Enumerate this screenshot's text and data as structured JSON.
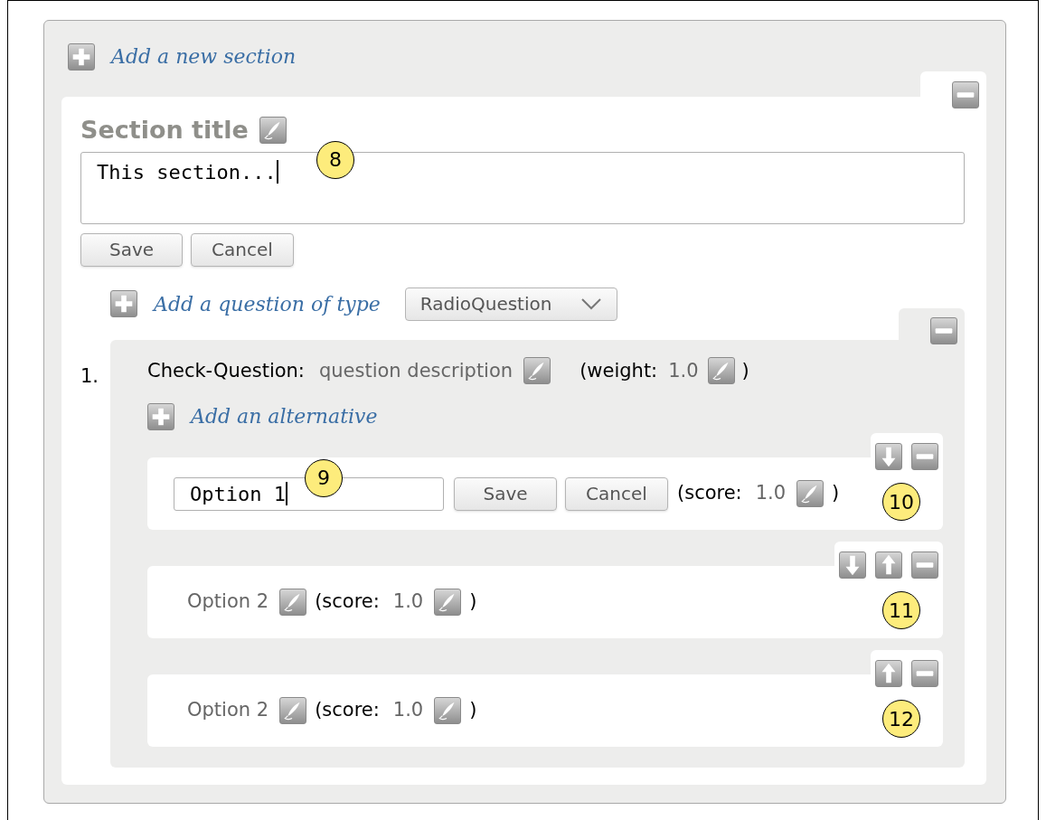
{
  "add_section": {
    "label": "Add a new section"
  },
  "section": {
    "title": "Section title",
    "description": {
      "value": "This section...",
      "focused": true,
      "callout": "8"
    },
    "buttons": [
      "Save",
      "Cancel"
    ],
    "add_question": {
      "label": "Add a question of type",
      "select_value": "RadioQuestion"
    },
    "questions": [
      {
        "number": "1.",
        "type_label": "Check-Question:",
        "description": "question description",
        "weight_label": "(weight:",
        "weight": "1.0",
        "weight_close": ")",
        "add_alternative": "Add an alternative",
        "alternatives": [
          {
            "kind": "editing",
            "value": "Option 1",
            "focused": true,
            "field_callout": "9",
            "buttons": [
              "Save",
              "Cancel"
            ],
            "score_label": "(score:",
            "score": "1.0",
            "score_close": ")",
            "controls": [
              {
                "kind": "down"
              },
              {
                "kind": "remove"
              }
            ],
            "callout": "10"
          },
          {
            "kind": "display",
            "label": "Option 2",
            "score_label": "(score:",
            "score": "1.0",
            "score_close": ")",
            "controls": [
              {
                "kind": "down"
              },
              {
                "kind": "up"
              },
              {
                "kind": "remove"
              }
            ],
            "callout": "11"
          },
          {
            "kind": "display",
            "label": "Option 2",
            "score_label": "(score:",
            "score": "1.0",
            "score_close": ")",
            "controls": [
              {
                "kind": "up"
              },
              {
                "kind": "remove"
              }
            ],
            "callout": "12"
          }
        ]
      }
    ]
  }
}
